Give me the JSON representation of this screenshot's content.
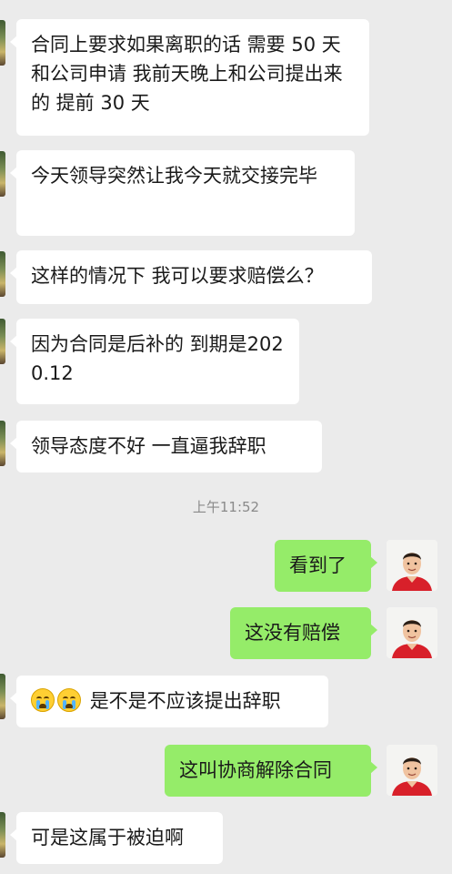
{
  "messages": [
    {
      "side": "left",
      "text": "合同上要求如果离职的话 需要 50 天和公司申请  我前天晚上和公司提出来的  提前 30 天"
    },
    {
      "side": "left",
      "text": "今天领导突然让我今天就交接完毕"
    },
    {
      "side": "left",
      "text": "这样的情况下  我可以要求赔偿么？"
    },
    {
      "side": "left",
      "text": "因为合同是后补的  到期是2020.12"
    },
    {
      "side": "left",
      "text": "领导态度不好  一直逼我辞职"
    },
    {
      "side": "right",
      "text": "看到了"
    },
    {
      "side": "right",
      "text": "这没有赔偿"
    },
    {
      "side": "left",
      "text": "是不是不应该提出辞职",
      "icons": [
        "crying-face-icon",
        "crying-face-icon"
      ]
    },
    {
      "side": "right",
      "text": "这叫协商解除合同"
    },
    {
      "side": "left",
      "text": "可是这属于被迫啊"
    }
  ],
  "timestamp": "上午11:52",
  "colors": {
    "background": "#ebebeb",
    "incoming_bubble": "#ffffff",
    "outgoing_bubble": "#95ec69",
    "timestamp_text": "#8a8a8a"
  }
}
